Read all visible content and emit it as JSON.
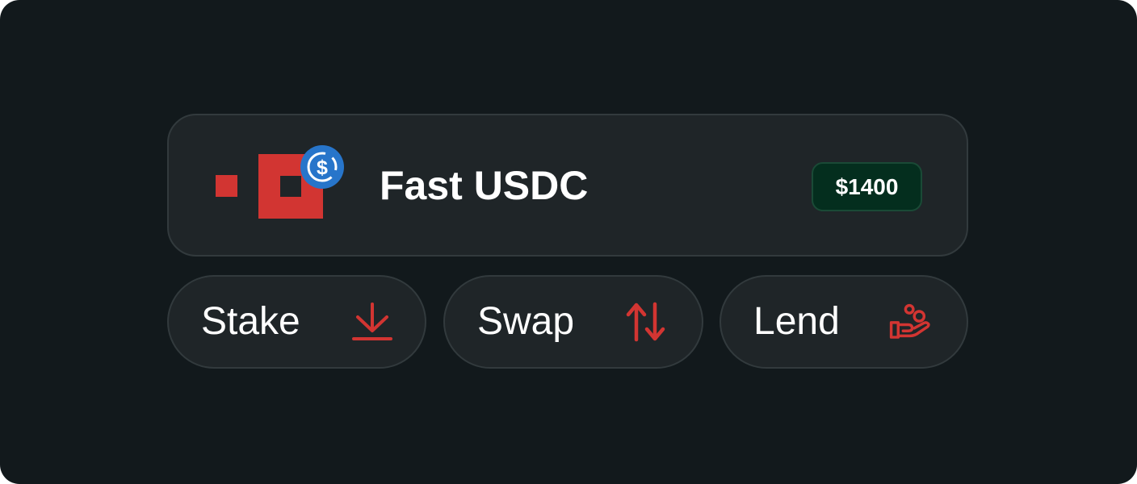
{
  "token": {
    "name": "Fast USDC",
    "value": "$1400",
    "logo_icon": "red-square-logo",
    "badge_icon": "usdc-dollar-icon"
  },
  "actions": [
    {
      "label": "Stake",
      "icon": "download-icon"
    },
    {
      "label": "Swap",
      "icon": "swap-arrows-icon"
    },
    {
      "label": "Lend",
      "icon": "hand-coins-icon"
    }
  ],
  "colors": {
    "background": "#12191c",
    "card": "#1f2528",
    "border": "#323a3d",
    "accent_red": "#d23532",
    "usdc_blue": "#2775ca",
    "value_pill_bg": "#042e1e"
  }
}
